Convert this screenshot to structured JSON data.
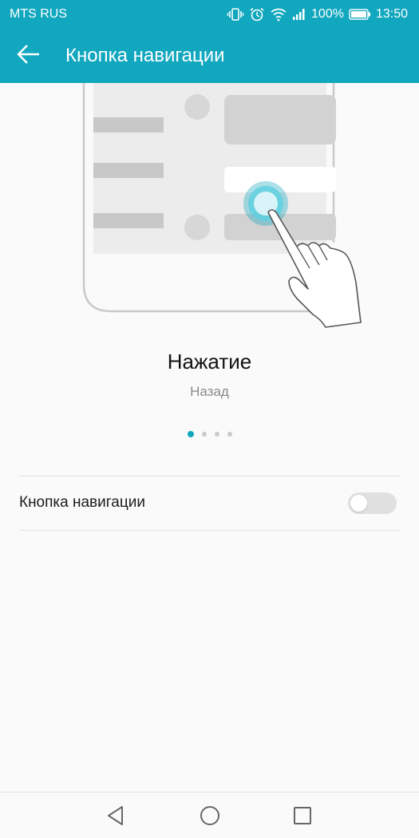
{
  "status_bar": {
    "carrier": "MTS RUS",
    "battery": "100%",
    "time": "13:50",
    "icons": [
      "vibrate-icon",
      "alarm-icon",
      "wifi-icon",
      "signal-icon",
      "battery-icon"
    ]
  },
  "app_bar": {
    "title": "Кнопка навигации",
    "back_icon": "arrow-left-icon"
  },
  "gesture": {
    "title": "Нажатие",
    "subtitle": "Назад"
  },
  "pager": {
    "count": 4,
    "active_index": 0
  },
  "settings": {
    "nav_button": {
      "label": "Кнопка навигации",
      "enabled": false
    }
  },
  "navigation_bar": {
    "buttons": [
      "triangle-back-icon",
      "circle-home-icon",
      "square-recents-icon"
    ]
  },
  "colors": {
    "accent": "#11a7bf",
    "background": "#fafafa",
    "toggle_off": "#e0e0e0"
  }
}
